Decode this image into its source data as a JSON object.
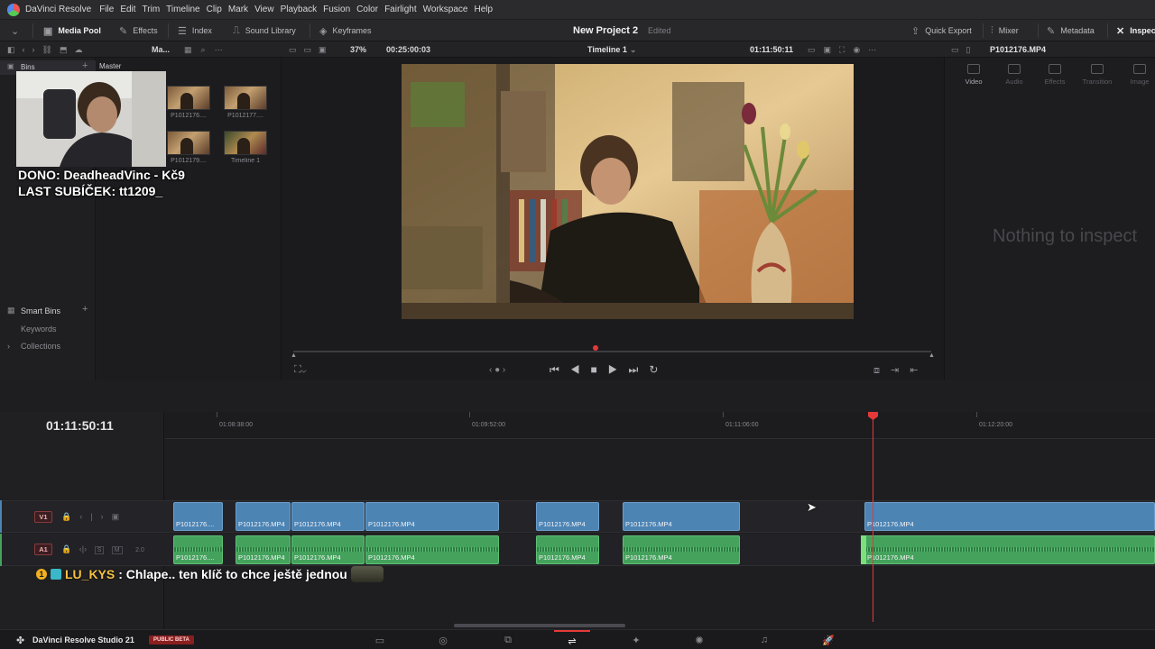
{
  "app": {
    "name": "DaVinci Resolve"
  },
  "menu": [
    "File",
    "Edit",
    "Trim",
    "Timeline",
    "Clip",
    "Mark",
    "View",
    "Playback",
    "Fusion",
    "Color",
    "Fairlight",
    "Workspace",
    "Help"
  ],
  "toolbar": {
    "media_pool": "Media Pool",
    "effects": "Effects",
    "index": "Index",
    "sound_library": "Sound Library",
    "keyframes": "Keyframes",
    "project_title": "New Project 2",
    "project_status": "Edited",
    "quick_export": "Quick Export",
    "mixer": "Mixer",
    "metadata": "Metadata",
    "inspector": "Inspector"
  },
  "subbar": {
    "sort": "Ma...",
    "zoom": "37%",
    "duration": "00:25:00:03",
    "timeline_name": "Timeline 1",
    "source_timecode": "01:11:50:11",
    "clip_name": "P1012176.MP4"
  },
  "bins": {
    "header": "Bins",
    "master": "Master",
    "smart_bins": "Smart Bins",
    "keywords": "Keywords",
    "collections": "Collections"
  },
  "media": [
    {
      "label": "P1012176...."
    },
    {
      "label": "P1012177...."
    },
    {
      "label": "P1012179...."
    },
    {
      "label": "Timeline 1"
    }
  ],
  "inspector": {
    "tabs": [
      "Video",
      "Audio",
      "Effects",
      "Transition",
      "Image"
    ],
    "empty": "Nothing to inspect"
  },
  "timeline": {
    "timecode": "01:11:50:11",
    "ruler": [
      "01:08:38:00",
      "01:09:52:00",
      "01:11:06:00",
      "01:12:20:00"
    ],
    "v1": "V1",
    "a1": "A1",
    "a1_level": "2.0",
    "solo": "S",
    "mute": "M"
  },
  "clips_video": [
    {
      "label": "P1012176...."
    },
    {
      "label": "P1012176.MP4"
    },
    {
      "label": "P1012176.MP4"
    },
    {
      "label": "P1012176.MP4"
    },
    {
      "label": "P1012176.MP4"
    },
    {
      "label": "P1012176.MP4"
    },
    {
      "label": "P1012176.MP4"
    }
  ],
  "clips_audio": [
    {
      "label": "P1012176...."
    },
    {
      "label": "P1012176.MP4"
    },
    {
      "label": "P1012176.MP4"
    },
    {
      "label": "P1012176.MP4"
    },
    {
      "label": "P1012176.MP4"
    },
    {
      "label": "P1012176.MP4"
    },
    {
      "label": "P1012176.MP4"
    }
  ],
  "footer": {
    "product": "DaVinci Resolve Studio 21",
    "badge": "PUBLIC BETA"
  },
  "stream_overlay": {
    "dono": "DONO: DeadheadVinc - Kč9",
    "last_sub": "LAST SUBÍČEK: tt1209_",
    "chat_user": "LU_KYS",
    "chat_message": ": Chlape.. ten klíč to chce ještě jednou"
  },
  "colors": {
    "video_clip": "#4c84b4",
    "audio_clip": "#44a25c",
    "playhead": "#e53939",
    "accent": "#e53939",
    "chat_user": "#f4c242"
  }
}
